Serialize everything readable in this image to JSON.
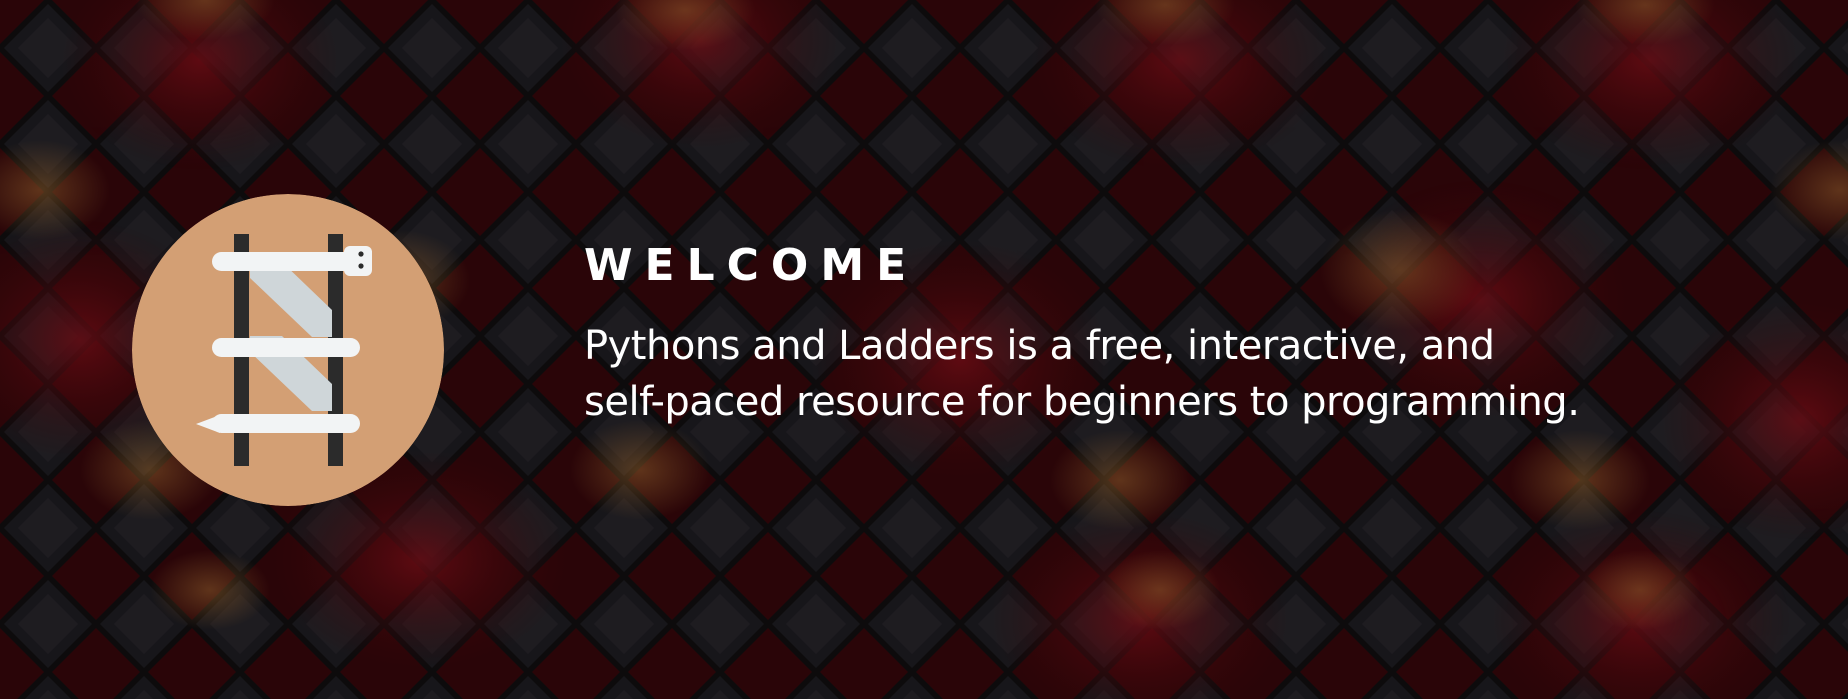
{
  "hero": {
    "heading": "WELCOME",
    "tagline_line1": "Pythons and Ladders is a free, interactive, and",
    "tagline_line2": "self-paced resource for beginners to programming.",
    "logo_icon": "ladder-snake-icon"
  },
  "colors": {
    "background": "#0d0b0c",
    "diamond_dark": "#1c1c1f",
    "diamond_red": "#5a0a10",
    "diamond_glow": "#8a5a2a",
    "logo_circle": "#d39f74",
    "ladder_rail": "#2b2b2b",
    "snake_body": "#f2f4f5",
    "snake_shadow": "#cfd6d9",
    "text": "#ffffff"
  }
}
